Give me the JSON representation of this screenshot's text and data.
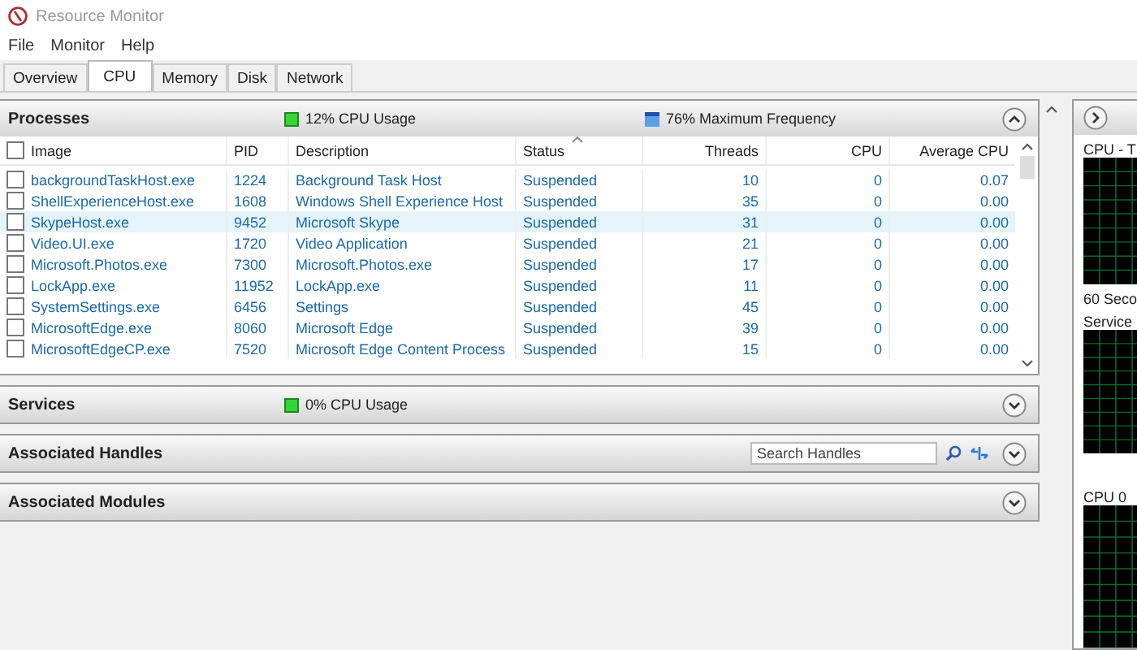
{
  "window": {
    "title": "Resource Monitor"
  },
  "menu": [
    "File",
    "Monitor",
    "Help"
  ],
  "tabs": [
    {
      "label": "Overview",
      "selected": false
    },
    {
      "label": "CPU",
      "selected": true
    },
    {
      "label": "Memory",
      "selected": false
    },
    {
      "label": "Disk",
      "selected": false
    },
    {
      "label": "Network",
      "selected": false
    }
  ],
  "processes": {
    "title": "Processes",
    "usage": "12% CPU Usage",
    "frequency": "76% Maximum Frequency",
    "expanded": true,
    "all_checked": false,
    "columns": [
      "Image",
      "PID",
      "Description",
      "Status",
      "Threads",
      "CPU",
      "Average CPU"
    ],
    "rows": [
      {
        "image": "backgroundTaskHost.exe",
        "pid": "1224",
        "description": "Background Task Host",
        "status": "Suspended",
        "threads": "10",
        "cpu": "0",
        "average_cpu": "0.07",
        "checked": false,
        "selected": false
      },
      {
        "image": "ShellExperienceHost.exe",
        "pid": "1608",
        "description": "Windows Shell Experience Host",
        "status": "Suspended",
        "threads": "35",
        "cpu": "0",
        "average_cpu": "0.00",
        "checked": false,
        "selected": false
      },
      {
        "image": "SkypeHost.exe",
        "pid": "9452",
        "description": "Microsoft Skype",
        "status": "Suspended",
        "threads": "31",
        "cpu": "0",
        "average_cpu": "0.00",
        "checked": false,
        "selected": true
      },
      {
        "image": "Video.UI.exe",
        "pid": "1720",
        "description": "Video Application",
        "status": "Suspended",
        "threads": "21",
        "cpu": "0",
        "average_cpu": "0.00",
        "checked": false,
        "selected": false
      },
      {
        "image": "Microsoft.Photos.exe",
        "pid": "7300",
        "description": "Microsoft.Photos.exe",
        "status": "Suspended",
        "threads": "17",
        "cpu": "0",
        "average_cpu": "0.00",
        "checked": false,
        "selected": false
      },
      {
        "image": "LockApp.exe",
        "pid": "11952",
        "description": "LockApp.exe",
        "status": "Suspended",
        "threads": "11",
        "cpu": "0",
        "average_cpu": "0.00",
        "checked": false,
        "selected": false
      },
      {
        "image": "SystemSettings.exe",
        "pid": "6456",
        "description": "Settings",
        "status": "Suspended",
        "threads": "45",
        "cpu": "0",
        "average_cpu": "0.00",
        "checked": false,
        "selected": false
      },
      {
        "image": "MicrosoftEdge.exe",
        "pid": "8060",
        "description": "Microsoft Edge",
        "status": "Suspended",
        "threads": "39",
        "cpu": "0",
        "average_cpu": "0.00",
        "checked": false,
        "selected": false
      },
      {
        "image": "MicrosoftEdgeCP.exe",
        "pid": "7520",
        "description": "Microsoft Edge Content Process",
        "status": "Suspended",
        "threads": "15",
        "cpu": "0",
        "average_cpu": "0.00",
        "checked": false,
        "selected": false
      }
    ]
  },
  "sections": [
    {
      "kind": "usage",
      "title": "Services",
      "usage": "0% CPU Usage",
      "expanded": false
    },
    {
      "kind": "search",
      "title": "Associated Handles",
      "placeholder": "Search Handles",
      "expanded": false
    },
    {
      "kind": "plain",
      "title": "Associated Modules",
      "expanded": false
    }
  ],
  "side_panel": {
    "labels": [
      "CPU - T",
      "60 Seco",
      "Service",
      "CPU 0"
    ]
  }
}
